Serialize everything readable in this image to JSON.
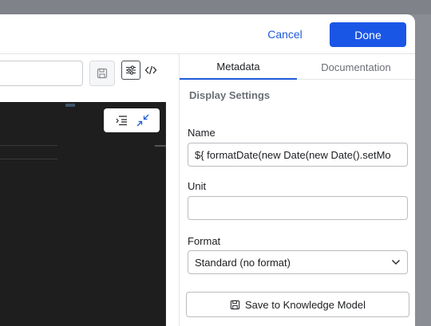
{
  "header": {
    "cancel_label": "Cancel",
    "done_label": "Done"
  },
  "colors": {
    "accent": "#1a56e6",
    "link": "#1f5bd9",
    "editor_bg": "#1e1e1e"
  },
  "icons": {
    "save": "floppy-disk-icon",
    "settings": "sliders-icon",
    "code": "code-icon",
    "list": "list-indent-icon",
    "collapse": "collapse-arrows-icon",
    "chevron": "chevron-down-icon"
  },
  "tabs": [
    {
      "label": "Metadata",
      "active": true
    },
    {
      "label": "Documentation",
      "active": false
    }
  ],
  "panel": {
    "section_title": "Display Settings",
    "name_label": "Name",
    "name_value": "${ formatDate(new Date(new Date().setMo",
    "unit_label": "Unit",
    "unit_value": "",
    "format_label": "Format",
    "format_value": "Standard (no format)",
    "kb_button_label": "Save to Knowledge Model"
  }
}
